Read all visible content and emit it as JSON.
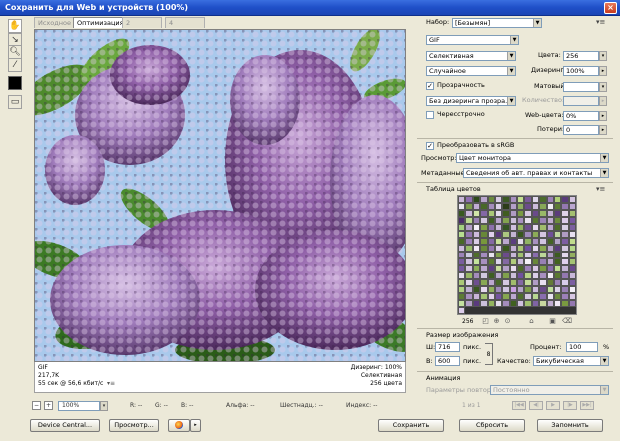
{
  "window": {
    "title": "Сохранить для Web и устройств (100%)",
    "close_glyph": "×"
  },
  "tabs": [
    {
      "label": "Исходное",
      "active": false
    },
    {
      "label": "Оптимизация",
      "active": true
    },
    {
      "label": "2 варианта",
      "active": false
    },
    {
      "label": "4 варианта",
      "active": false
    }
  ],
  "preview_info": {
    "format": "GIF",
    "size": "217,7K",
    "time": "55 сек @ 56,6 кбит/с",
    "menu_glyph": "▾≡",
    "dither_line": "Дизеринг: 100%",
    "palette_line": "Селективная",
    "colors_line": "256 цвета"
  },
  "statusbar": {
    "zoom": "100%",
    "r": "R: --",
    "g": "G: --",
    "b": "B: --",
    "alpha": "Альфа: --",
    "hex": "Шестнадц.: --",
    "index": "Индекс: --"
  },
  "bottom_buttons": {
    "device_central": "Device Central...",
    "preview": "Просмотр...",
    "save": "Сохранить",
    "reset": "Сбросить",
    "remember": "Запомнить"
  },
  "settings": {
    "preset_label": "Набор:",
    "preset_value": "[Безымян]",
    "format_value": "GIF",
    "palette_value": "Селективная",
    "dither_algo_value": "Случайное",
    "transparency_label": "Прозрачность",
    "transparency_checked": true,
    "matte_dither_value": "Без дизеринга прозра...",
    "interlaced_label": "Чересстрочно",
    "interlaced_checked": false,
    "colors_label": "Цвета:",
    "colors_value": "256",
    "dither_label": "Дизеринг:",
    "dither_value": "100%",
    "matte_label": "Матовый:",
    "amount_label": "Количество:",
    "websnap_label": "Web-цвета:",
    "websnap_value": "0%",
    "lossy_label": "Потери:",
    "lossy_value": "0",
    "srgb_label": "Преобразовать в sRGB",
    "srgb_checked": true,
    "preview_label": "Просмотр:",
    "preview_value": "Цвет монитора",
    "metadata_label": "Метаданные:",
    "metadata_value": "Сведения об авт. правах и контакты"
  },
  "color_table": {
    "title": "Таблица цветов",
    "count": "256",
    "colors": [
      "#c9b7d8",
      "#8f6fb0",
      "#2e4a1a",
      "#b8a4cc",
      "#6a8a3c",
      "#d8cce4",
      "#3c5a24",
      "#a890c0",
      "#c4e090",
      "#7a5a9a",
      "#e0d8ec",
      "#4c6c2c",
      "#9c80b8",
      "#b0d078",
      "#5a3c7c",
      "#d4c4e0",
      "#e8e4f0",
      "#7c9c4c",
      "#c0acd4",
      "#486828",
      "#a48cbc",
      "#dcd0e8",
      "#2c3c18",
      "#b4a0c8",
      "#90b060",
      "#6c4c8c",
      "#ccbcdc",
      "#88a858",
      "#f0ecf4",
      "#5c7c34",
      "#9478b0",
      "#bca8d0",
      "#385820",
      "#c8b4d8",
      "#d0e4a8",
      "#8468a4",
      "#aac878",
      "#e4dcee",
      "#405c20",
      "#b09cc4",
      "#7a9a44",
      "#d8c8e4",
      "#6a4a8a",
      "#98b868",
      "#c4b0d4",
      "#5c3c7c",
      "#e0d4ea",
      "#a4c070",
      "#4a2c6a",
      "#bcd890",
      "#9880b4",
      "#d4c8e0",
      "#3e5e22",
      "#b8a4cc",
      "#84a450",
      "#ccc0dc",
      "#a890c0",
      "#e8e0f0",
      "#587830",
      "#9c84b8",
      "#c0ac d0",
      "#6c8c3c",
      "#dcccea",
      "#7858a0",
      "#a4d080",
      "#b4a0c8",
      "#f4f0f8",
      "#80a048",
      "#8c70ac",
      "#c8b8d8",
      "#345424",
      "#d0c0e0",
      "#94b460",
      "#6e4e8e",
      "#e4d8ee",
      "#a0bc6c",
      "#bca8d0",
      "#4c6c28",
      "#d8d0e4",
      "#7c60a0",
      "#b8e090",
      "#9478b0",
      "#ccbcdc",
      "#688838",
      "#e0d0ec",
      "#5a3a7a",
      "#acc880",
      "#c4b4d4",
      "#38581e",
      "#a08cbc",
      "#8cac58",
      "#d4c4e0",
      "#70509a",
      "#c0d8a0",
      "#b09cc4",
      "#e8e0f0",
      "#486a26",
      "#9c80b8",
      "#d8cce4",
      "#78983c",
      "#8468a4",
      "#c8e098",
      "#bca8d0",
      "#5c3e80",
      "#e4dcee",
      "#90b464",
      "#a890c0",
      "#d0c4e0",
      "#446424",
      "#b4a4c8",
      "#7e5ea2",
      "#c0dc8c",
      "#ccbcdc",
      "#98bc68",
      "#f0e8f4",
      "#6a8a3a",
      "#9478b0",
      "#dcd0e8",
      "#3a5a1e",
      "#c4b0d4",
      "#a8c474",
      "#7050a0",
      "#e0d4ec",
      "#88a850",
      "#b8a4cc",
      "#5a3c7c",
      "#d4c8e0",
      "#b4d888",
      "#9c84b8",
      "#cccce0",
      "#4e6e2a",
      "#a48cc0",
      "#e8e4f0",
      "#82a24c",
      "#6c4c8c",
      "#c8b8d8",
      "#a0c070",
      "#d8ccea",
      "#8a6eae",
      "#bcd898",
      "#b09cc4",
      "#3c5c20",
      "#e4d8ee",
      "#94b060",
      "#7a5ca0",
      "#d0c0e0",
      "#c4e49c",
      "#a890c0",
      "#5c7c30",
      "#dcd4ea",
      "#8468a4",
      "#b0cc7c",
      "#ccbcdc",
      "#f4f0f8",
      "#688838",
      "#9880b4",
      "#c0acd0",
      "#44641e",
      "#e0d0ec",
      "#a4c474",
      "#7658a0",
      "#d4c4e0",
      "#8cb058",
      "#bca8d0",
      "#5e3e82",
      "#c8dc9c",
      "#b4a0c8",
      "#e8dcf0",
      "#4c6a28",
      "#9c80b8",
      "#d8c8e4",
      "#7a9a44",
      "#8a6cac",
      "#c0e090",
      "#c4b4d4",
      "#6a4a8e",
      "#e4dcee",
      "#98b864",
      "#a48cbc",
      "#d0c8e0",
      "#3e5e22",
      "#b8a8cc",
      "#80a04c",
      "#ccc0dc",
      "#7050a0",
      "#b8d488",
      "#dcd0e8",
      "#a890c0",
      "#f0ecf4",
      "#5a7a30",
      "#9478b0",
      "#c8b8d8",
      "#acc878",
      "#e0d4ea",
      "#6e4e90",
      "#88a854",
      "#bca8d0",
      "#48682a",
      "#d4c8e0",
      "#a0bc6c",
      "#8468a4",
      "#c4dc98",
      "#b09cc4",
      "#e8e0f0",
      "#647c38",
      "#9c84b8",
      "#d8ccea",
      "#7c60a2",
      "#b0d080",
      "#c0b0d4",
      "#3a5820",
      "#e4d8ee",
      "#90b05c",
      "#a08cbc",
      "#d0c4e0",
      "#caa0e4",
      "#b4a4c8",
      "#7e9e48",
      "#ccbcdc",
      "#6a4a8a",
      "#c0e09c",
      "#dcd4ea",
      "#9880b4",
      "#f4f0f8",
      "#5c7c34",
      "#a890c0",
      "#c8b4d8",
      "#a4c474",
      "#e0d0ec",
      "#7454a0",
      "#86a650",
      "#bca8d0",
      "#4e6e2c",
      "#d4c8e0",
      "#b8d890",
      "#8a6eae",
      "#e8e4f0",
      "#6c8c3c",
      "#9c80b8",
      "#d8c8e4",
      "#c4e0a0",
      "#b4a0c8",
      "#5a3a7e",
      "#ccc0dc",
      "#94b460",
      "#e4dcee",
      "#a48cbc",
      "#406020",
      "#d0c0e0",
      "#a0c070",
      "#8064a4",
      "#c8d8a0",
      "#c0acd0",
      "#f0e8f4",
      "#7a9a40",
      "#9478b0",
      "#dcccea"
    ]
  },
  "image_size": {
    "title": "Размер изображения",
    "w_label": "Ш:",
    "w_value": "716",
    "h_label": "В:",
    "h_value": "600",
    "unit": "пикс.",
    "percent_label": "Процент:",
    "percent_value": "100",
    "percent_sign": "%",
    "quality_label": "Качество:",
    "quality_value": "Бикубическая"
  },
  "animation": {
    "title": "Анимация",
    "loop_label": "Параметры повтора:",
    "loop_value": "Постоянно",
    "frame_counter": "1 из 1"
  }
}
